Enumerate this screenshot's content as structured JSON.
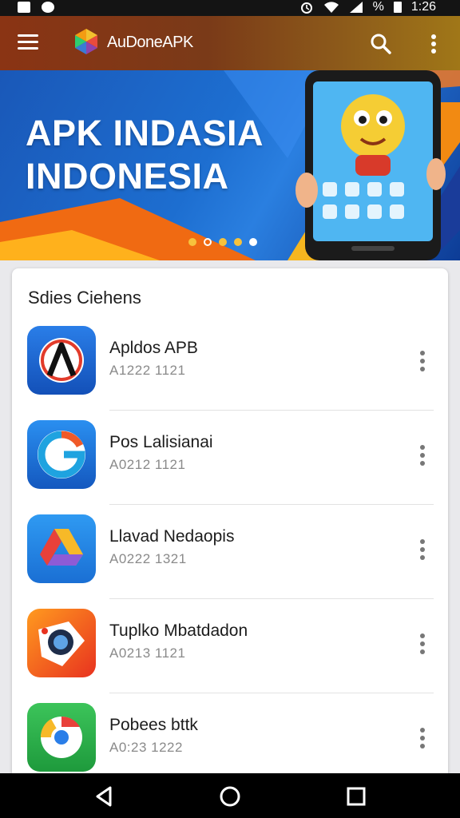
{
  "status_bar": {
    "time": "1:26",
    "battery_text": "%",
    "left_icons": [
      "notification-icon",
      "whatsapp-icon"
    ],
    "right_icons": [
      "alarm-icon",
      "wifi-icon",
      "signal-icon",
      "battery-icon"
    ]
  },
  "app_bar": {
    "title": "AuDoneAPK",
    "icons": [
      "menu-icon",
      "app-logo",
      "search-icon",
      "more-vert-icon"
    ]
  },
  "banner": {
    "line1": "APK INDASIA",
    "line2": "INDONESIA",
    "slides": 5,
    "active_slide": 5
  },
  "list": {
    "header": "Sdies Ciehens",
    "items": [
      {
        "name": "Apldos APB",
        "sub": "A1222 1121",
        "icon": "app-a-icon"
      },
      {
        "name": "Pos Lalisianai",
        "sub": "A0212 1121",
        "icon": "app-g-icon"
      },
      {
        "name": "Llavad Nedaopis",
        "sub": "A0222 1321",
        "icon": "drive-icon"
      },
      {
        "name": "Tuplko Mbatdadon",
        "sub": "A0213 1121",
        "icon": "camera-icon"
      },
      {
        "name": "Pobees bttk",
        "sub": "A0:23 1222",
        "icon": "chrome-icon"
      }
    ]
  },
  "nav_bar": {
    "icons": [
      "back-icon",
      "home-icon",
      "recents-icon"
    ]
  }
}
